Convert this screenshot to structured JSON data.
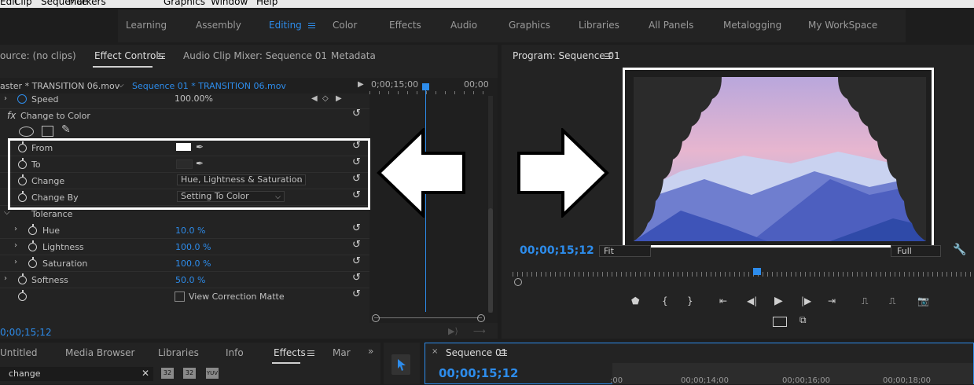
{
  "menu": [
    "Edit",
    "Clip",
    "Sequence",
    "Markers",
    "Graphics",
    "Window",
    "Help"
  ],
  "workspaces": {
    "items": [
      "Learning",
      "Assembly",
      "Editing",
      "Color",
      "Effects",
      "Audio",
      "Graphics",
      "Libraries",
      "All Panels",
      "Metalogging",
      "My WorkSpace"
    ],
    "active": "Editing"
  },
  "left_panel": {
    "tabs": [
      "ource: (no clips)",
      "Effect Controls",
      "Audio Clip Mixer: Sequence 01",
      "Metadata"
    ],
    "master_clip": "aster * TRANSITION 06.mov",
    "sequence_clip": "Sequence 01 * TRANSITION 06.mov",
    "ruler_time_1": "0;00;15;00",
    "ruler_time_2": "00;00",
    "speed_label": "Speed",
    "speed_value": "100.00%",
    "effect_name": "Change to Color",
    "fx_label": "fx",
    "from_label": "From",
    "to_label": "To",
    "change_label": "Change",
    "change_value": "Hue, Lightness & Saturation",
    "change_by_label": "Change By",
    "change_by_value": "Setting To Color",
    "tolerance_label": "Tolerance",
    "hue_label": "Hue",
    "hue_value": "10.0 %",
    "lightness_label": "Lightness",
    "lightness_value": "100.0 %",
    "saturation_label": "Saturation",
    "saturation_value": "100.0 %",
    "softness_label": "Softness",
    "softness_value": "50.0 %",
    "view_matte_label": "View Correction Matte",
    "timecode": "0;00;15;12",
    "from_color": "#ffffff",
    "to_color": "#2b2b2b"
  },
  "program": {
    "title": "Program: Sequence 01",
    "timecode": "00;00;15;12",
    "fit": "Fit",
    "quality": "Full",
    "playhead_percent": 53
  },
  "project_panel": {
    "tabs": [
      "Untitled",
      "Media Browser",
      "Libraries",
      "Info",
      "Effects",
      "Mar"
    ],
    "active": "Effects",
    "search_value": "change",
    "bins": [
      "32",
      "32",
      "YUV"
    ]
  },
  "timeline": {
    "title": "Sequence 01",
    "timecode": "00;00;15;12",
    "ticks": [
      ":00",
      "00;00;14;00",
      "00;00;16;00",
      "00;00;18;00"
    ]
  },
  "colors": {
    "accent": "#2d8ceb",
    "panel_bg": "#232323",
    "app_bg": "#1d1d1d"
  }
}
